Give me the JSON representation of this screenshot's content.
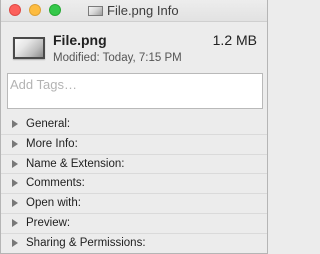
{
  "window": {
    "title": "File.png Info",
    "title_icon": "image-file-icon"
  },
  "header": {
    "file_name": "File.png",
    "file_size": "1.2 MB",
    "modified": "Modified: Today, 7:15 PM",
    "file_icon": "image-thumbnail-icon"
  },
  "tags": {
    "placeholder": "Add Tags…",
    "value": ""
  },
  "sections": [
    {
      "label": "General:"
    },
    {
      "label": "More Info:"
    },
    {
      "label": "Name & Extension:"
    },
    {
      "label": "Comments:"
    },
    {
      "label": "Open with:"
    },
    {
      "label": "Preview:"
    },
    {
      "label": "Sharing & Permissions:"
    }
  ],
  "colors": {
    "close": "#fc605b",
    "minimize": "#fdbc40",
    "maximize": "#34c84a",
    "window_bg": "#ececec"
  }
}
